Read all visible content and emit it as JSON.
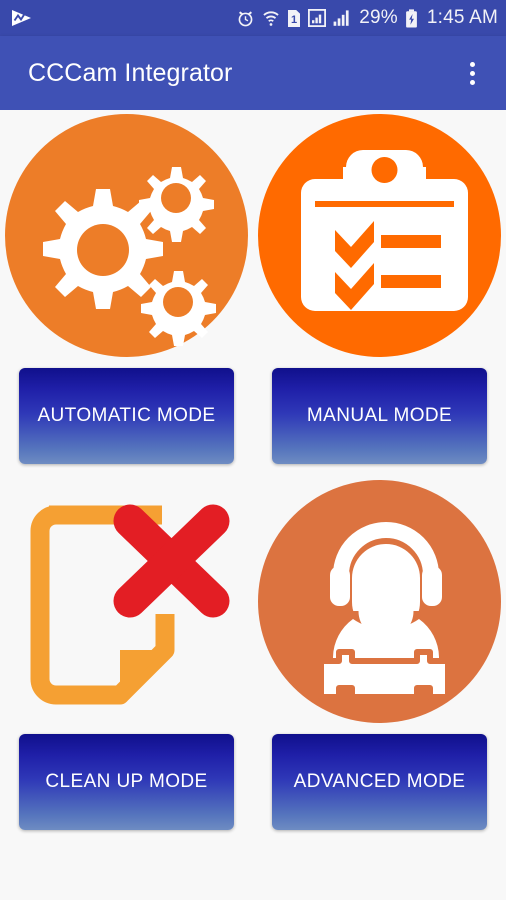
{
  "status_bar": {
    "background": "#3949ab",
    "notification_icon": "media-play-notification-icon",
    "icons": [
      "alarm-clock-icon",
      "wifi-icon",
      "sim-card-1-icon",
      "mobile-signal-boxed-icon",
      "mobile-signal-icon"
    ],
    "battery_percent": "29%",
    "battery_icon": "battery-charging-icon",
    "clock": "1:45 AM"
  },
  "app_bar": {
    "title": "CCCam Integrator",
    "background": "#3f51b5",
    "overflow_icon": "overflow-menu-icon"
  },
  "theme": {
    "page_background": "#f8f8f8",
    "button_gradient_top": "#10108c",
    "button_gradient_bottom": "#6e8cc2",
    "button_text": "#ffffff"
  },
  "tiles": [
    {
      "id": "automatic-mode",
      "label": "AUTOMATIC MODE",
      "icon": "gears-icon",
      "circle_color": "#ed7d28",
      "has_circle": true,
      "glyph_color": "#ffffff"
    },
    {
      "id": "manual-mode",
      "label": "MANUAL MODE",
      "icon": "clipboard-checklist-icon",
      "circle_color": "#ff6a00",
      "has_circle": true,
      "glyph_color": "#ffffff"
    },
    {
      "id": "clean-up-mode",
      "label": "CLEAN UP MODE",
      "icon": "document-delete-icon",
      "circle_color": "",
      "has_circle": false,
      "glyph_color": "#f5a033",
      "accent_color": "#e31e24"
    },
    {
      "id": "advanced-mode",
      "label": "ADVANCED MODE",
      "icon": "support-agent-wrench-icon",
      "circle_color": "#dc7340",
      "has_circle": true,
      "glyph_color": "#ffffff"
    }
  ]
}
